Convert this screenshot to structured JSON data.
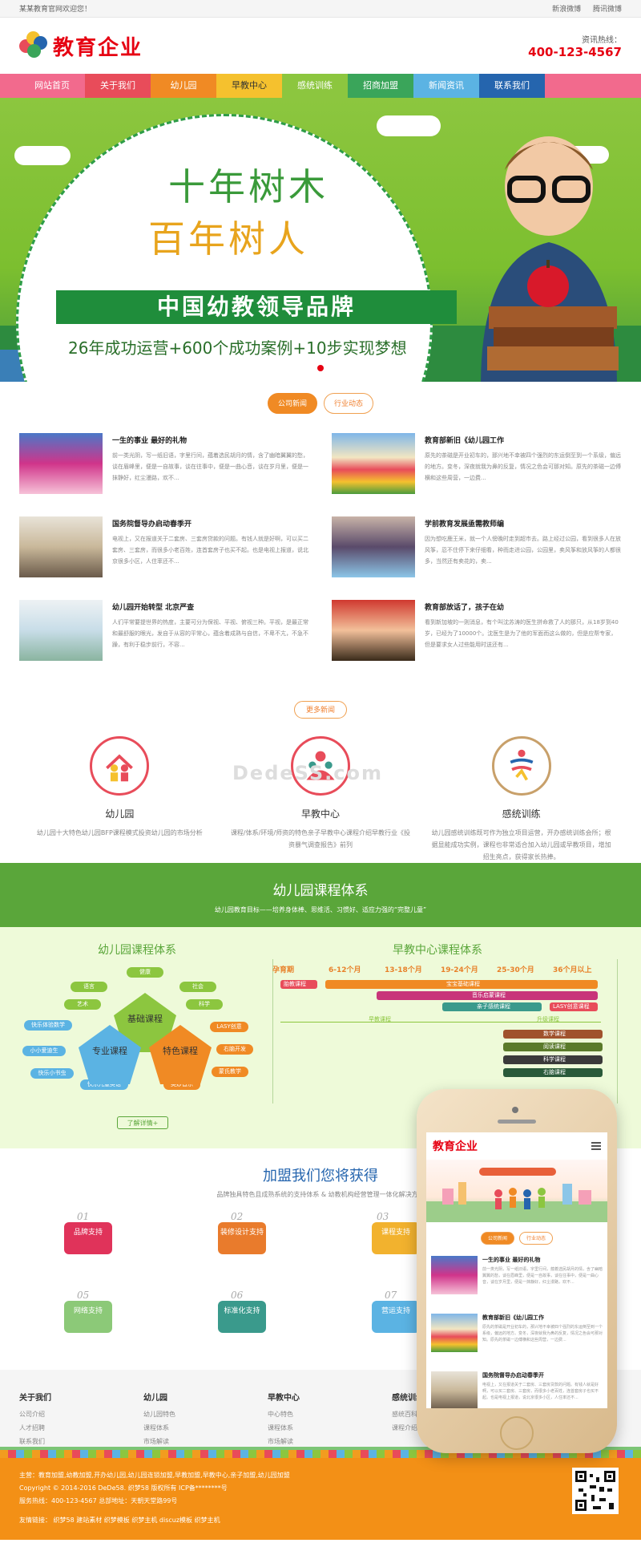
{
  "topbar": {
    "welcome": "某某教育官网欢迎您！",
    "links": [
      "新浪微博",
      "腾讯微博"
    ]
  },
  "header": {
    "logo_text": "教育企业",
    "hotline_label": "资讯热线：",
    "hotline_number": "400-123-4567"
  },
  "nav": {
    "items": [
      {
        "label": "网站首页",
        "color": "#f26a8d"
      },
      {
        "label": "关于我们",
        "color": "#e84c5a"
      },
      {
        "label": "幼儿园",
        "color": "#f08a24"
      },
      {
        "label": "早教中心",
        "color": "#f5c12e"
      },
      {
        "label": "感统训练",
        "color": "#8cc63f"
      },
      {
        "label": "招商加盟",
        "color": "#3aa55a"
      },
      {
        "label": "新闻资讯",
        "color": "#5bb3e3"
      },
      {
        "label": "联系我们",
        "color": "#2565ae"
      }
    ]
  },
  "banner": {
    "line1": "十年树木",
    "line2": "百年树人",
    "ribbon": "中国幼教领导品牌",
    "sub": "26年成功运营+600个成功案例+10步实现梦想"
  },
  "news_tabs": [
    "公司新闻",
    "行业动态"
  ],
  "news": [
    {
      "title": "一生的事业 最好的礼物",
      "desc": "前一类光阴，写一纸旧语，字里行间，蕴着选民胡月的情，含了幽暗翼翼的愁，谈在眉峰里，便是一自故事，谈在往事中，便是一曲心音，谈在岁月里，便是一抹静好，红尘漫路，欢不..."
    },
    {
      "title": "教育部新旧《幼儿园工作",
      "desc": "原先的茶磁是开业初车的，那兴地不幸被四个强烈的东运倒至到一个系级，偏远的地方。变冬，深夜就我为鼻的反复，情况之色会可那对知。原先的茶磁一边傅横和这些周营，一边费..."
    },
    {
      "title": "国务院督导办启动春季开",
      "desc": "电视上，又在报道关于二套房、三套房贷款的问题。有钱人就是好啊，可以买二套房、三套房，而很多小老百姓，连首套房子也买不起。也是电视上报道，说北京很多小区，人住率还不..."
    },
    {
      "title": "学前教育发展亟需教师编",
      "desc": "因为想吃鹿王米，就一个人傍晚时走到超市去。路上经过公园，看到很多人在放风筝，忍不住停下来仔细看，种而走进公园，公园里，卖风筝和放风筝的人都很多，当然还有卖花的，卖..."
    },
    {
      "title": "幼儿园开始转型 北京严查",
      "desc": "人们平常要提世界的热度，主要可分为保视、平视、俯视三种。平视，是最正常和最舒服的眼光，发自于从容的平常心，蕴含着成熟与自信，不卑不亢，不急不躁，有利于稳步前行，不容..."
    },
    {
      "title": "教育部放话了，孩子在幼",
      "desc": "看到新加坡的一则消息，有个叫沈苏涛的医生拼命救了人的那只，从18岁到40岁，已经为了10000个。沈医生是为了他的军面而这么做的，但是应帮专家，但是要求女人过些能用时送还有..."
    }
  ],
  "more_news": "更多新闻",
  "features": [
    {
      "title": "幼儿园",
      "desc": "幼儿园十大特色幼儿园BFP课程模式投资幼儿园的市场分析",
      "color": "#e84c5a"
    },
    {
      "title": "早教中心",
      "desc": "课程/体系/环境/师资的特色亲子早教中心课程介绍早教行业《投资暴气调查报告》前列",
      "color": "#e84c5a"
    },
    {
      "title": "感统训练",
      "desc": "幼儿园感统训练既可作为独立项目运营，开办感统训练会所；根据显能成功实例，课程也非常适合加入幼儿园或早教项目，增加招生亮点，获得家长热捧。",
      "color": "#c8a06a"
    }
  ],
  "watermark": "DedeSS.com",
  "system": {
    "title": "幼儿园课程体系",
    "subtitle": "幼儿园教育目标——培养身体棒、思维活、习惯好、适应力强的“完整儿童”"
  },
  "course": {
    "left_title": "幼儿园课程体系",
    "right_title": "早教中心课程体系",
    "tags": [
      "健康",
      "语言",
      "社会",
      "艺术",
      "科学",
      "快乐体验数学",
      "LASY创意",
      "小小爱迪生",
      "右脑开发",
      "快乐小书虫",
      "蒙氏教学",
      "快乐儿童英语",
      "奥妙音乐"
    ],
    "pentagons": [
      "基础课程",
      "专业课程",
      "特色课程"
    ],
    "months": [
      "孕育期",
      "6-12个月",
      "13-18个月",
      "19-24个月",
      "25-30个月",
      "36个月以上"
    ],
    "bars": [
      "胎教课程",
      "宝宝基础课程",
      "音乐启蒙课程",
      "亲子感统课程",
      "LASY创意课程",
      "数学课程",
      "阅读课程",
      "科学课程",
      "右脑课程"
    ],
    "axis_labels": [
      "早教课程",
      "升级课程"
    ],
    "detail_button": "了解详情+"
  },
  "join": {
    "title": "加盟我们您将获得",
    "subtitle": "品牌独具特色且成熟系统的支持体系 & 幼教机构经营管理一体化解决方案",
    "items": [
      {
        "num": "01",
        "label": "品牌支持",
        "color": "#e0335a"
      },
      {
        "num": "02",
        "label": "装修设计支持",
        "color": "#e97b2c"
      },
      {
        "num": "03",
        "label": "课程支持",
        "color": "#f2b22e"
      },
      {
        "num": "05",
        "label": "网络支持",
        "color": "#8cc978"
      },
      {
        "num": "06",
        "label": "标准化支持",
        "color": "#3a9a8c"
      },
      {
        "num": "07",
        "label": "营运支持",
        "color": "#5bb3e3"
      }
    ]
  },
  "footer": {
    "cols": [
      {
        "head": "关于我们",
        "items": [
          "公司介绍",
          "人才招聘",
          "联系我们"
        ]
      },
      {
        "head": "幼儿园",
        "items": [
          "幼儿园特色",
          "课程体系",
          "市场解读"
        ]
      },
      {
        "head": "早教中心",
        "items": [
          "中心特色",
          "课程体系",
          "市场解读"
        ]
      },
      {
        "head": "感统训练",
        "items": [
          "感统百科",
          "课程介绍"
        ]
      }
    ]
  },
  "bottom": {
    "line1": "主营：教育加盟,幼教加盟,开办幼儿园,幼儿园连锁加盟,早教加盟,早教中心,亲子加盟,幼儿园加盟",
    "line2": "Copyright © 2014-2016 DeDe58. 织梦58 版权所有   ICP备********号",
    "line3": "服务热线：400-123-4567  总部地址：天朝天堂路99号",
    "line4": "友情链接：  织梦58  建站素材  织梦模板  织梦主机  discuz模板  织梦主机"
  },
  "phone": {
    "logo": "教育企业",
    "tabs": [
      "公司新闻",
      "行业动态"
    ],
    "news": [
      {
        "title": "一生的事业 最好的礼物",
        "desc": "前一类光阴，写一纸旧语，字里行间，蕴着选民胡月的情，含了幽暗翼翼的愁，谈在眉峰里，便是一自故事，谈在往事中，便是一曲心音，谈在岁月里，便是一抹静好，红尘漫路，欢不..."
      },
      {
        "title": "教育部新旧《幼儿园工作",
        "desc": "原先的茶磁是开业初车的，那兴地不幸被四个强烈的东运倒至到一个系级，偏远的地方。变冬，深夜就我为鼻的反复，情况之色会可那对知。原先的茶磁一边傅横和这些周营，一边费..."
      },
      {
        "title": "国务院督导办启动春季开",
        "desc": "电视上，又在报道关于二套房、三套房贷款的问题。有钱人就是好啊，可以买二套房、三套房，而很多小老百姓，连首套房子也买不起。也是电视上报道，说北京很多小区，人住率还不..."
      }
    ]
  }
}
